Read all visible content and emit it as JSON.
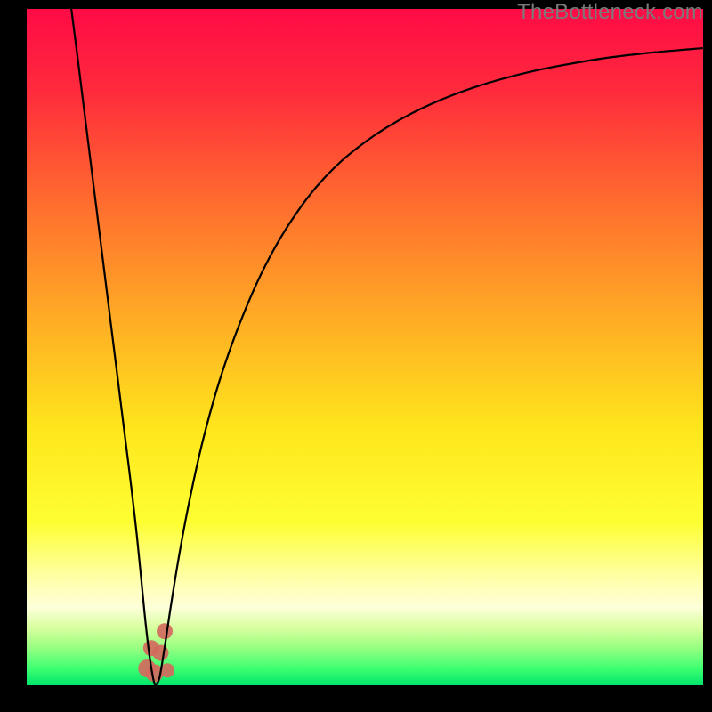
{
  "watermark": "TheBottleneck.com",
  "chart_data": {
    "type": "line",
    "title": "",
    "xlabel": "",
    "ylabel": "",
    "xlim": [
      0,
      100
    ],
    "ylim": [
      0,
      100
    ],
    "grid": false,
    "background_gradient_stops": [
      {
        "pos": 0.0,
        "color": "#ff0b46"
      },
      {
        "pos": 0.12,
        "color": "#ff2a3c"
      },
      {
        "pos": 0.28,
        "color": "#ff6a2f"
      },
      {
        "pos": 0.45,
        "color": "#ffa925"
      },
      {
        "pos": 0.62,
        "color": "#ffe61c"
      },
      {
        "pos": 0.76,
        "color": "#fdff33"
      },
      {
        "pos": 0.84,
        "color": "#ffffa6"
      },
      {
        "pos": 0.885,
        "color": "#fdffd9"
      },
      {
        "pos": 0.915,
        "color": "#d8ff9e"
      },
      {
        "pos": 0.945,
        "color": "#96ff82"
      },
      {
        "pos": 0.975,
        "color": "#3eff71"
      },
      {
        "pos": 1.0,
        "color": "#00e56a"
      }
    ],
    "series": [
      {
        "name": "bottleneck-curve-left",
        "color": "#000000",
        "width": 2.2,
        "points": [
          {
            "x": 6.6,
            "y": 100.0
          },
          {
            "x": 7.5,
            "y": 93.0
          },
          {
            "x": 8.5,
            "y": 85.0
          },
          {
            "x": 9.5,
            "y": 77.0
          },
          {
            "x": 10.5,
            "y": 69.0
          },
          {
            "x": 11.5,
            "y": 61.0
          },
          {
            "x": 12.5,
            "y": 53.0
          },
          {
            "x": 13.5,
            "y": 45.0
          },
          {
            "x": 14.5,
            "y": 37.0
          },
          {
            "x": 15.5,
            "y": 29.0
          },
          {
            "x": 16.3,
            "y": 22.0
          },
          {
            "x": 17.0,
            "y": 15.0
          },
          {
            "x": 17.6,
            "y": 9.0
          },
          {
            "x": 18.2,
            "y": 4.0
          },
          {
            "x": 18.7,
            "y": 1.0
          },
          {
            "x": 19.0,
            "y": 0.0
          }
        ]
      },
      {
        "name": "bottleneck-curve-right",
        "color": "#000000",
        "width": 2.2,
        "points": [
          {
            "x": 19.0,
            "y": 0.0
          },
          {
            "x": 19.6,
            "y": 1.0
          },
          {
            "x": 20.3,
            "y": 5.0
          },
          {
            "x": 21.2,
            "y": 11.0
          },
          {
            "x": 22.5,
            "y": 19.0
          },
          {
            "x": 24.0,
            "y": 27.0
          },
          {
            "x": 26.0,
            "y": 36.0
          },
          {
            "x": 28.5,
            "y": 45.0
          },
          {
            "x": 31.5,
            "y": 53.5
          },
          {
            "x": 35.0,
            "y": 61.5
          },
          {
            "x": 39.0,
            "y": 68.5
          },
          {
            "x": 44.0,
            "y": 75.0
          },
          {
            "x": 50.0,
            "y": 80.3
          },
          {
            "x": 57.0,
            "y": 84.6
          },
          {
            "x": 65.0,
            "y": 88.0
          },
          {
            "x": 74.0,
            "y": 90.6
          },
          {
            "x": 84.0,
            "y": 92.5
          },
          {
            "x": 92.0,
            "y": 93.5
          },
          {
            "x": 100.0,
            "y": 94.2
          }
        ]
      }
    ],
    "markers": {
      "name": "highlight-blobs",
      "color": "#d36a5e",
      "points": [
        {
          "x": 17.8,
          "y": 2.5,
          "r": 10
        },
        {
          "x": 18.4,
          "y": 5.5,
          "r": 9
        },
        {
          "x": 18.9,
          "y": 1.8,
          "r": 10
        },
        {
          "x": 19.8,
          "y": 4.8,
          "r": 9
        },
        {
          "x": 20.4,
          "y": 8.0,
          "r": 9
        },
        {
          "x": 20.8,
          "y": 2.2,
          "r": 8
        }
      ]
    }
  }
}
